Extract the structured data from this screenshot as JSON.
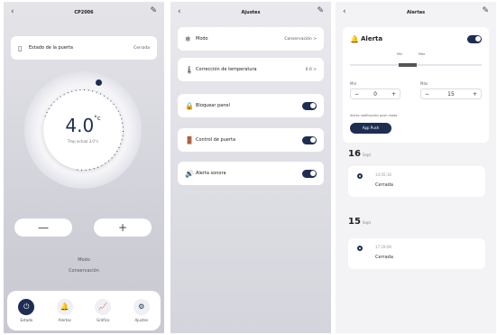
{
  "screen1": {
    "title": "CP2006",
    "back_icon": "chevron-left-icon",
    "edit_icon": "pencil-icon",
    "door_label": "Estado de la puerta",
    "door_value": "Cerrada",
    "temperature": "4.0",
    "unit": "°c",
    "subtext": "Tmp actual 3.0°c",
    "minus": "—",
    "plus": "+",
    "mode_label": "Modo",
    "mode_value": "Conservación",
    "tabs": [
      {
        "label": "Estado",
        "icon": "power-icon",
        "glyph": "⏻"
      },
      {
        "label": "Alertas",
        "icon": "bell-icon",
        "glyph": "🔔"
      },
      {
        "label": "Gráfico",
        "icon": "chart-icon",
        "glyph": "📈"
      },
      {
        "label": "Ajustes",
        "icon": "gear-icon",
        "glyph": "⚙"
      }
    ]
  },
  "screen2": {
    "title": "Ajustes",
    "back_icon": "chevron-left-icon",
    "edit_icon": "pencil-icon",
    "items": [
      {
        "label": "Modo",
        "value": "Conservación >",
        "icon": "snowflake-icon",
        "glyph": "❄"
      },
      {
        "label": "Corrección de temperatura",
        "value": "0.0 >",
        "icon": "thermometer-icon",
        "glyph": "🌡"
      },
      {
        "label": "Bloquear panel",
        "icon": "lock-icon",
        "glyph": "🔒"
      },
      {
        "label": "Control de puerta",
        "icon": "door-icon",
        "glyph": "🚪"
      },
      {
        "label": "Alerta sonora",
        "icon": "speaker-icon",
        "glyph": "🔊"
      }
    ]
  },
  "screen3": {
    "title": "Alertas",
    "back_icon": "chevron-left-icon",
    "edit_icon": "pencil-icon",
    "alert_label": "Alerta",
    "range_low": "Mín",
    "range_high": "Máx",
    "min_label": "Mín",
    "max_label": "Máx",
    "min_value": "0",
    "max_value": "15",
    "minus": "−",
    "plus": "+",
    "note": "Alerta notificación push modo",
    "push_button": "App Push",
    "days": [
      {
        "day": "16",
        "month": "Sept",
        "time": "14:05:16",
        "state": "Cerrada"
      },
      {
        "day": "15",
        "month": "Sept",
        "time": "17:29:06",
        "state": "Cerrada"
      }
    ]
  }
}
